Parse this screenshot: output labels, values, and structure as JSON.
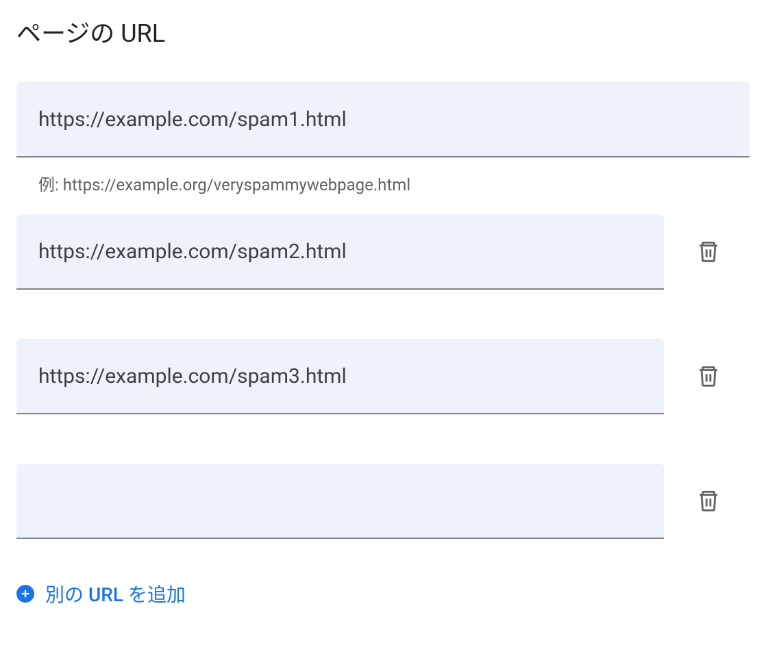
{
  "title": "ページの URL",
  "helper_text": "例: https://example.org/veryspammywebpage.html",
  "urls": [
    {
      "value": "https://example.com/spam1.html",
      "deletable": false
    },
    {
      "value": "https://example.com/spam2.html",
      "deletable": true
    },
    {
      "value": "https://example.com/spam3.html",
      "deletable": true
    },
    {
      "value": "",
      "deletable": true
    }
  ],
  "add_button": {
    "prefix": "別の ",
    "bold": "URL",
    "suffix": " を追加"
  }
}
